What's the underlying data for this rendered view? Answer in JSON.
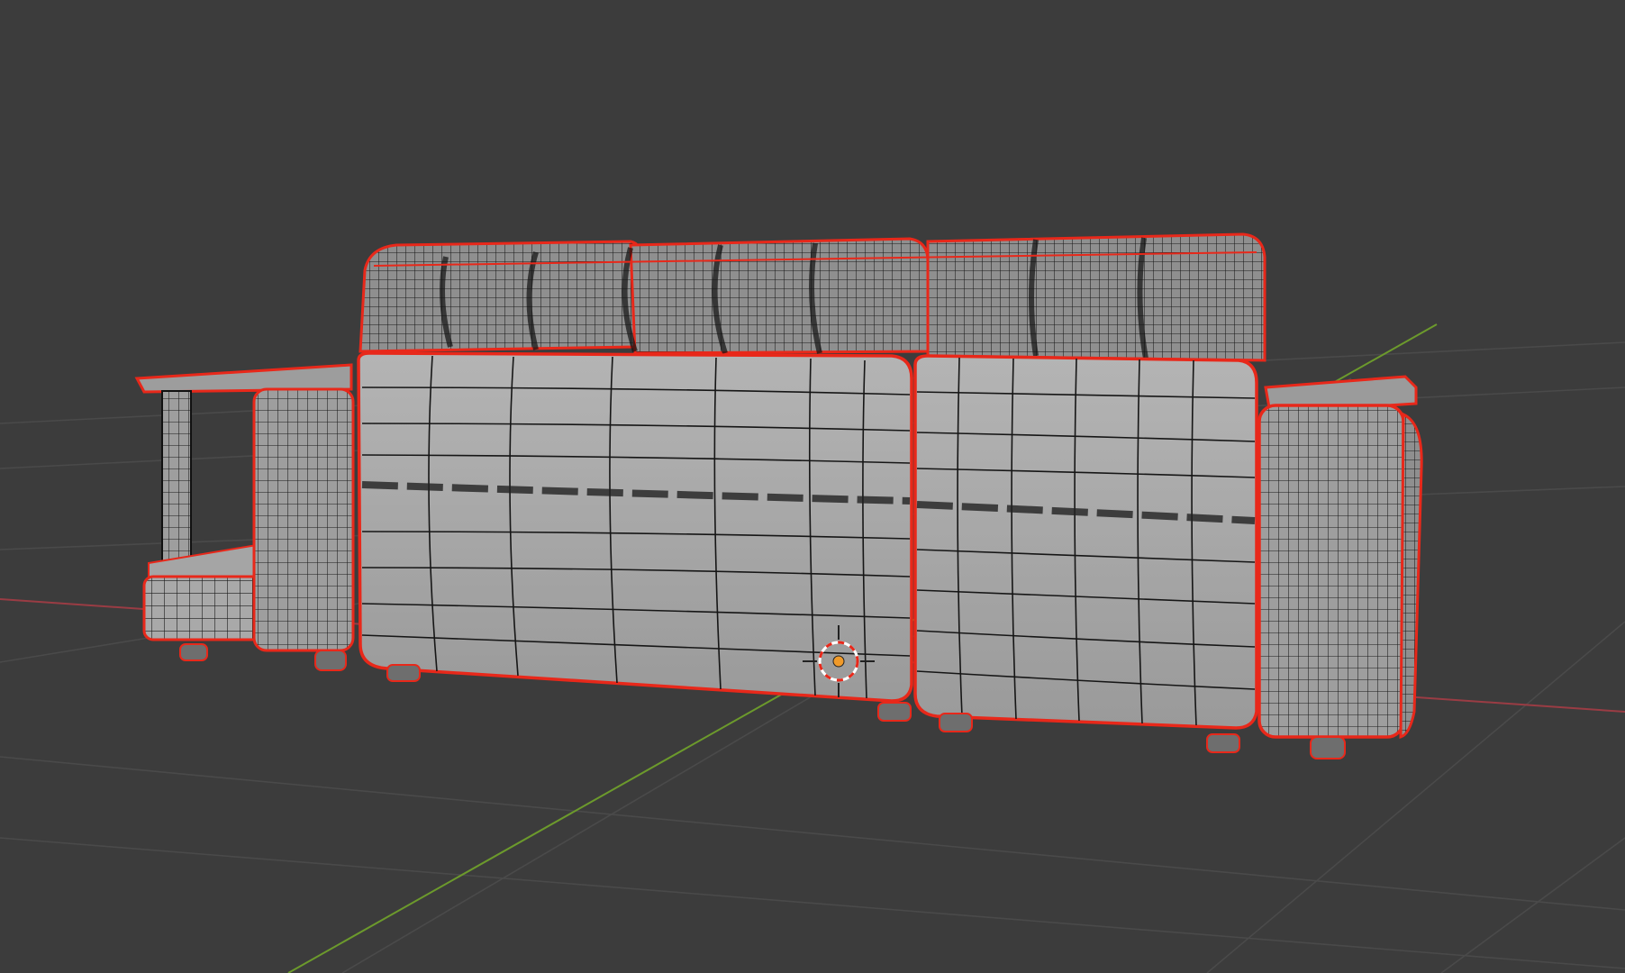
{
  "viewport": {
    "mode": "edit-mode-wireframe-overlay",
    "object": "sofa-mesh",
    "colors": {
      "background": "#3c3c3c",
      "grid_line": "#4a4a4a",
      "x_axis": "#9a3c44",
      "y_axis": "#6c9a2c",
      "mesh_face": "#a7a7a7",
      "mesh_face_dark": "#8c8c8c",
      "mesh_wire": "#111111",
      "selection_outline": "#e8281a",
      "origin_dot": "#f09a2a",
      "cursor_ring_a": "#e8281a",
      "cursor_ring_b": "#ffffff"
    },
    "icons": [
      "3d-cursor-icon",
      "origin-point-icon"
    ]
  }
}
